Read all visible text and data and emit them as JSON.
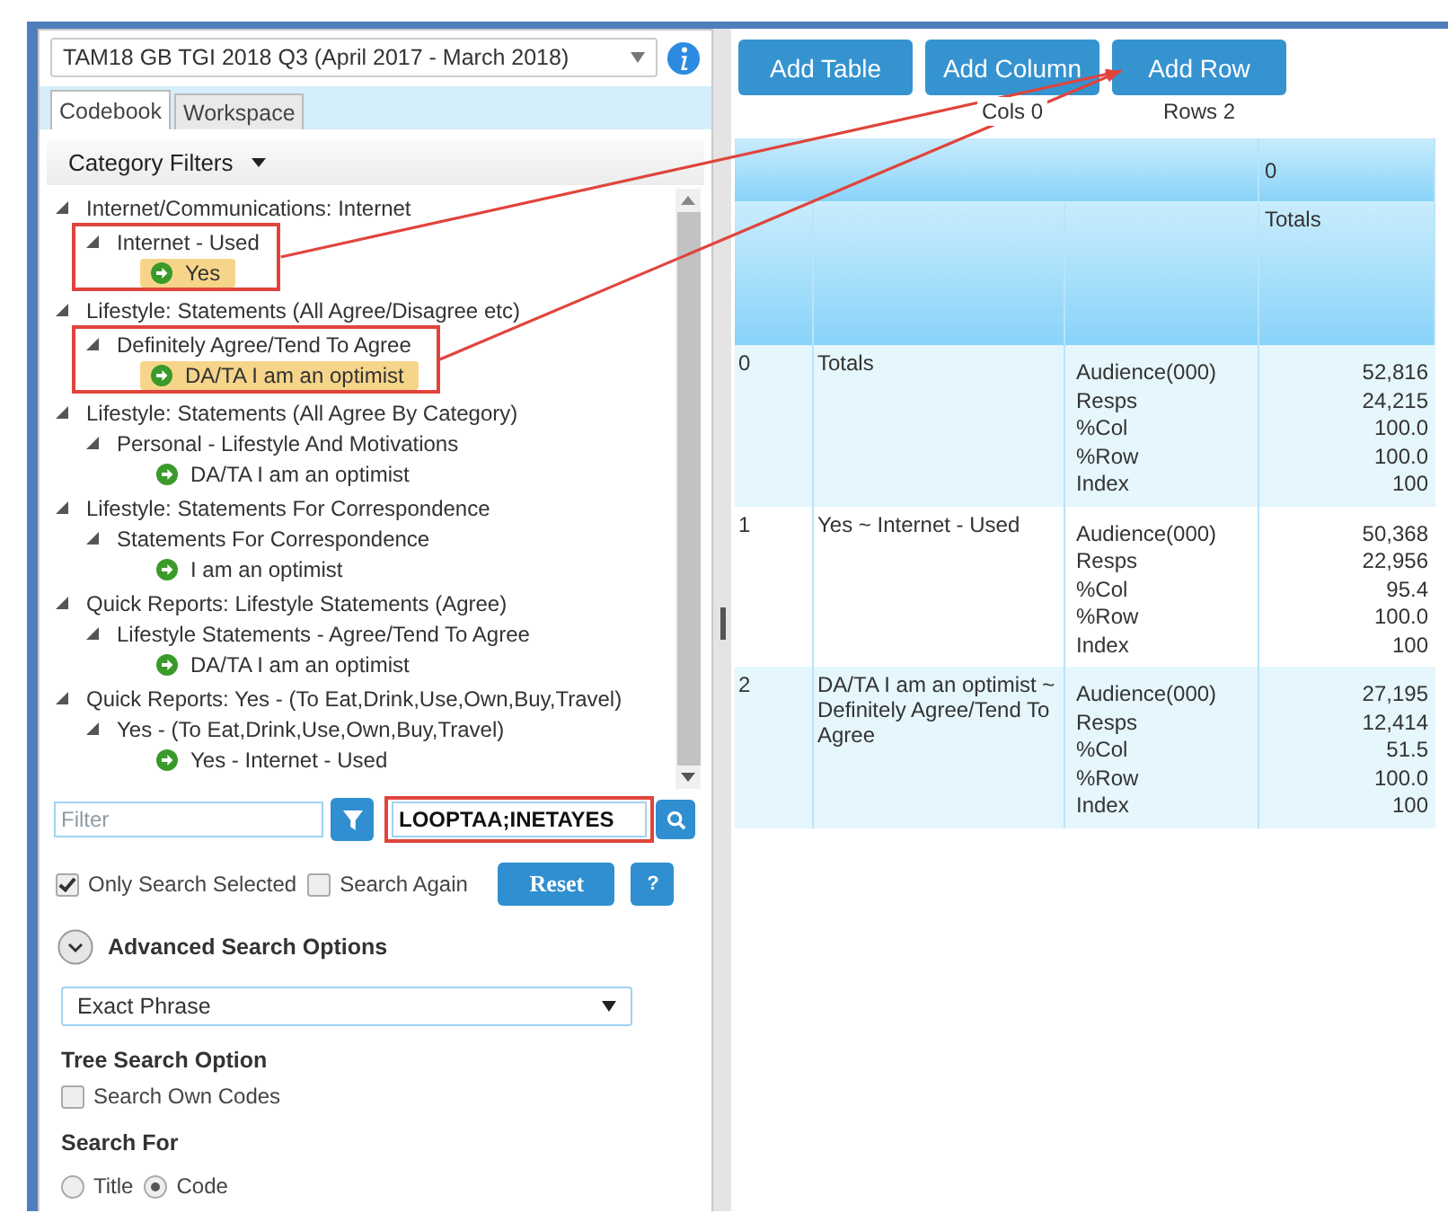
{
  "dataset_select": {
    "value": "TAM18 GB TGI 2018 Q3 (April 2017 - March 2018)"
  },
  "tabs": [
    {
      "label": "Codebook",
      "selected": true
    },
    {
      "label": "Workspace",
      "selected": false
    }
  ],
  "category_filters": {
    "label": "Category Filters"
  },
  "tree": [
    {
      "label": "Internet/Communications: Internet",
      "expanded": true,
      "children": [
        {
          "label": "Internet - Used",
          "expanded": true,
          "annotated": true,
          "children": [
            {
              "label": "Yes",
              "selected": true
            }
          ]
        }
      ]
    },
    {
      "label": "Lifestyle: Statements (All Agree/Disagree etc)",
      "expanded": true,
      "children": [
        {
          "label": "Definitely Agree/Tend To Agree",
          "expanded": true,
          "annotated": true,
          "children": [
            {
              "label": "DA/TA I am an optimist",
              "selected": true
            }
          ]
        }
      ]
    },
    {
      "label": "Lifestyle: Statements (All Agree By Category)",
      "expanded": true,
      "children": [
        {
          "label": "Personal - Lifestyle And Motivations",
          "expanded": true,
          "children": [
            {
              "label": "DA/TA I am an optimist",
              "selected": false
            }
          ]
        }
      ]
    },
    {
      "label": "Lifestyle: Statements For Correspondence",
      "expanded": true,
      "children": [
        {
          "label": "Statements For Correspondence",
          "expanded": true,
          "children": [
            {
              "label": "I am an optimist",
              "selected": false
            }
          ]
        }
      ]
    },
    {
      "label": "Quick Reports: Lifestyle Statements (Agree)",
      "expanded": true,
      "children": [
        {
          "label": "Lifestyle Statements - Agree/Tend To Agree",
          "expanded": true,
          "children": [
            {
              "label": "DA/TA I am an optimist",
              "selected": false
            }
          ]
        }
      ]
    },
    {
      "label": "Quick Reports: Yes - (To Eat,Drink,Use,Own,Buy,Travel)",
      "expanded": true,
      "children": [
        {
          "label": "Yes - (To Eat,Drink,Use,Own,Buy,Travel)",
          "expanded": true,
          "children": [
            {
              "label": "Yes - Internet - Used",
              "selected": false
            }
          ]
        }
      ]
    }
  ],
  "filter_field": {
    "placeholder": "Filter"
  },
  "search_field": {
    "value": "LOOPTAA;INETAYES",
    "annotated": true
  },
  "options": [
    {
      "label": "Only Search Selected",
      "checked": true
    },
    {
      "label": "Search Again",
      "checked": false
    }
  ],
  "reset_button": "Reset",
  "help_button": "?",
  "advanced": {
    "label": "Advanced Search Options",
    "expanded": true
  },
  "match_select": {
    "value": "Exact Phrase"
  },
  "tree_search": {
    "heading": "Tree Search Option",
    "options": [
      {
        "label": "Search Own Codes",
        "checked": false
      }
    ]
  },
  "search_for": {
    "heading": "Search For",
    "options": [
      {
        "label": "Title",
        "selected": false
      },
      {
        "label": "Code",
        "selected": true
      }
    ]
  },
  "toolbar": [
    {
      "label": "Add Table"
    },
    {
      "label": "Add Column",
      "count": "Cols 0"
    },
    {
      "label": "Add Row",
      "count": "Rows 2"
    }
  ],
  "table": {
    "column_header": "0",
    "column_label": "Totals",
    "rows": [
      {
        "index": "0",
        "label": "Totals",
        "stats": [
          "Audience(000)",
          "Resps",
          "%Col",
          "%Row",
          "Index"
        ],
        "values": [
          "52,816",
          "24,215",
          "100.0",
          "100.0",
          "100"
        ]
      },
      {
        "index": "1",
        "label": "Yes ~ Internet - Used",
        "stats": [
          "Audience(000)",
          "Resps",
          "%Col",
          "%Row",
          "Index"
        ],
        "values": [
          "50,368",
          "22,956",
          "95.4",
          "100.0",
          "100"
        ]
      },
      {
        "index": "2",
        "label": "DA/TA I am an optimist ~ Definitely Agree/Tend To Agree",
        "stats": [
          "Audience(000)",
          "Resps",
          "%Col",
          "%Row",
          "Index"
        ],
        "values": [
          "27,195",
          "12,414",
          "51.5",
          "100.0",
          "100"
        ]
      }
    ]
  }
}
